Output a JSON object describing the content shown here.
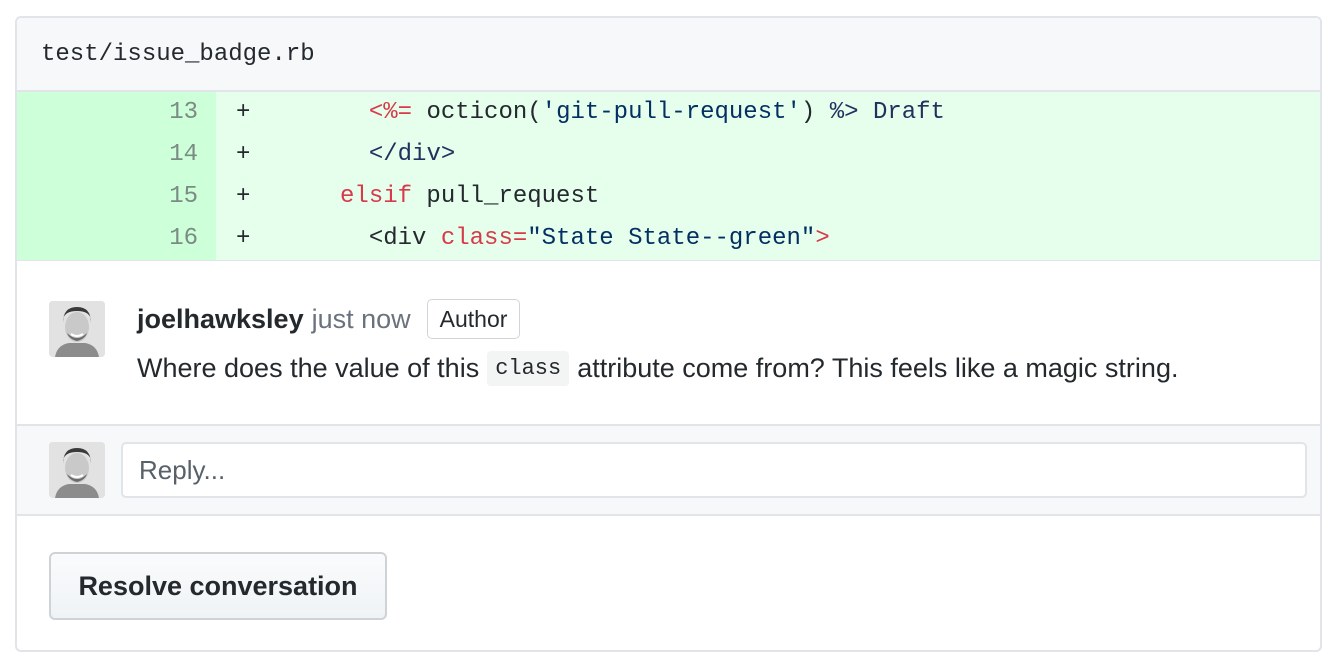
{
  "file": {
    "path": "test/issue_badge.rb"
  },
  "diff": {
    "lines": [
      {
        "num": "13",
        "marker": "+",
        "indent": "      ",
        "parts": [
          {
            "t": "<%=",
            "c": "red"
          },
          {
            "t": " octicon(",
            "c": "plain"
          },
          {
            "t": "'git-pull-request'",
            "c": "blue"
          },
          {
            "t": ") ",
            "c": "plain"
          },
          {
            "t": "%>",
            "c": "navy"
          },
          {
            "t": " Draft",
            "c": "navy"
          }
        ]
      },
      {
        "num": "14",
        "marker": "+",
        "indent": "      ",
        "parts": [
          {
            "t": "</div>",
            "c": "navy"
          }
        ]
      },
      {
        "num": "15",
        "marker": "+",
        "indent": "    ",
        "parts": [
          {
            "t": "elsif",
            "c": "red"
          },
          {
            "t": " pull_request",
            "c": "plain"
          }
        ]
      },
      {
        "num": "16",
        "marker": "+",
        "indent": "      ",
        "parts": [
          {
            "t": "<div ",
            "c": "plain"
          },
          {
            "t": "class=",
            "c": "red"
          },
          {
            "t": "\"State State--green\"",
            "c": "blue"
          },
          {
            "t": ">",
            "c": "red"
          }
        ]
      }
    ]
  },
  "comment": {
    "author": "joelhawksley",
    "time": "just now",
    "badge": "Author",
    "body_before": "Where does the value of this",
    "body_code": "class",
    "body_after": "attribute come from? This feels like a magic string."
  },
  "reply": {
    "placeholder": "Reply..."
  },
  "actions": {
    "resolve_label": "Resolve conversation"
  },
  "icons": {
    "avatar": "user-avatar"
  }
}
